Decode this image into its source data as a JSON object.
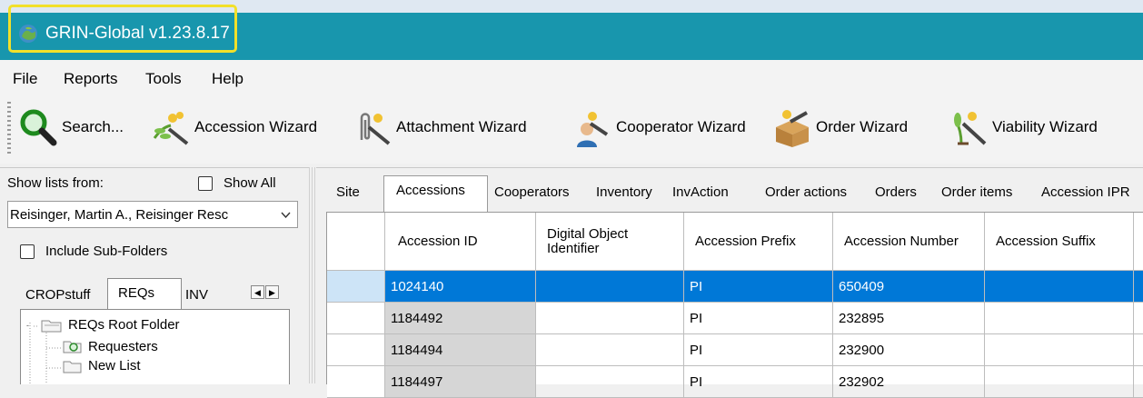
{
  "app": {
    "title": "GRIN-Global v1.23.8.17"
  },
  "menu": [
    "File",
    "Reports",
    "Tools",
    "Help"
  ],
  "toolbar": {
    "search": "Search...",
    "accession_wizard": "Accession Wizard",
    "attachment_wizard": "Attachment Wizard",
    "cooperator_wizard": "Cooperator Wizard",
    "order_wizard": "Order Wizard",
    "viability_wizard": "Viability Wizard"
  },
  "left": {
    "show_lists_from": "Show lists from:",
    "show_all": "Show All",
    "owner": "Reisinger, Martin A., Reisinger Resc",
    "include_subfolders": "Include Sub-Folders",
    "tabs": [
      "CROPstuff",
      "REQs",
      "INV"
    ],
    "active_tab": "REQs",
    "tree": [
      "REQs Root Folder",
      "Requesters",
      "New List"
    ]
  },
  "right": {
    "tabs": [
      "Site",
      "Accessions",
      "Cooperators",
      "Inventory",
      "InvAction",
      "Order actions",
      "Orders",
      "Order items",
      "Accession IPR"
    ],
    "active_tab": "Accessions",
    "columns": [
      "Accession ID",
      "Digital Object Identifier",
      "Accession Prefix",
      "Accession Number",
      "Accession Suffix"
    ],
    "rows": [
      {
        "id": "1024140",
        "doi": "",
        "prefix": "PI",
        "number": "650409",
        "suffix": ""
      },
      {
        "id": "1184492",
        "doi": "",
        "prefix": "PI",
        "number": "232895",
        "suffix": ""
      },
      {
        "id": "1184494",
        "doi": "",
        "prefix": "PI",
        "number": "232900",
        "suffix": ""
      },
      {
        "id": "1184497",
        "doi": "",
        "prefix": "PI",
        "number": "232902",
        "suffix": ""
      }
    ]
  }
}
